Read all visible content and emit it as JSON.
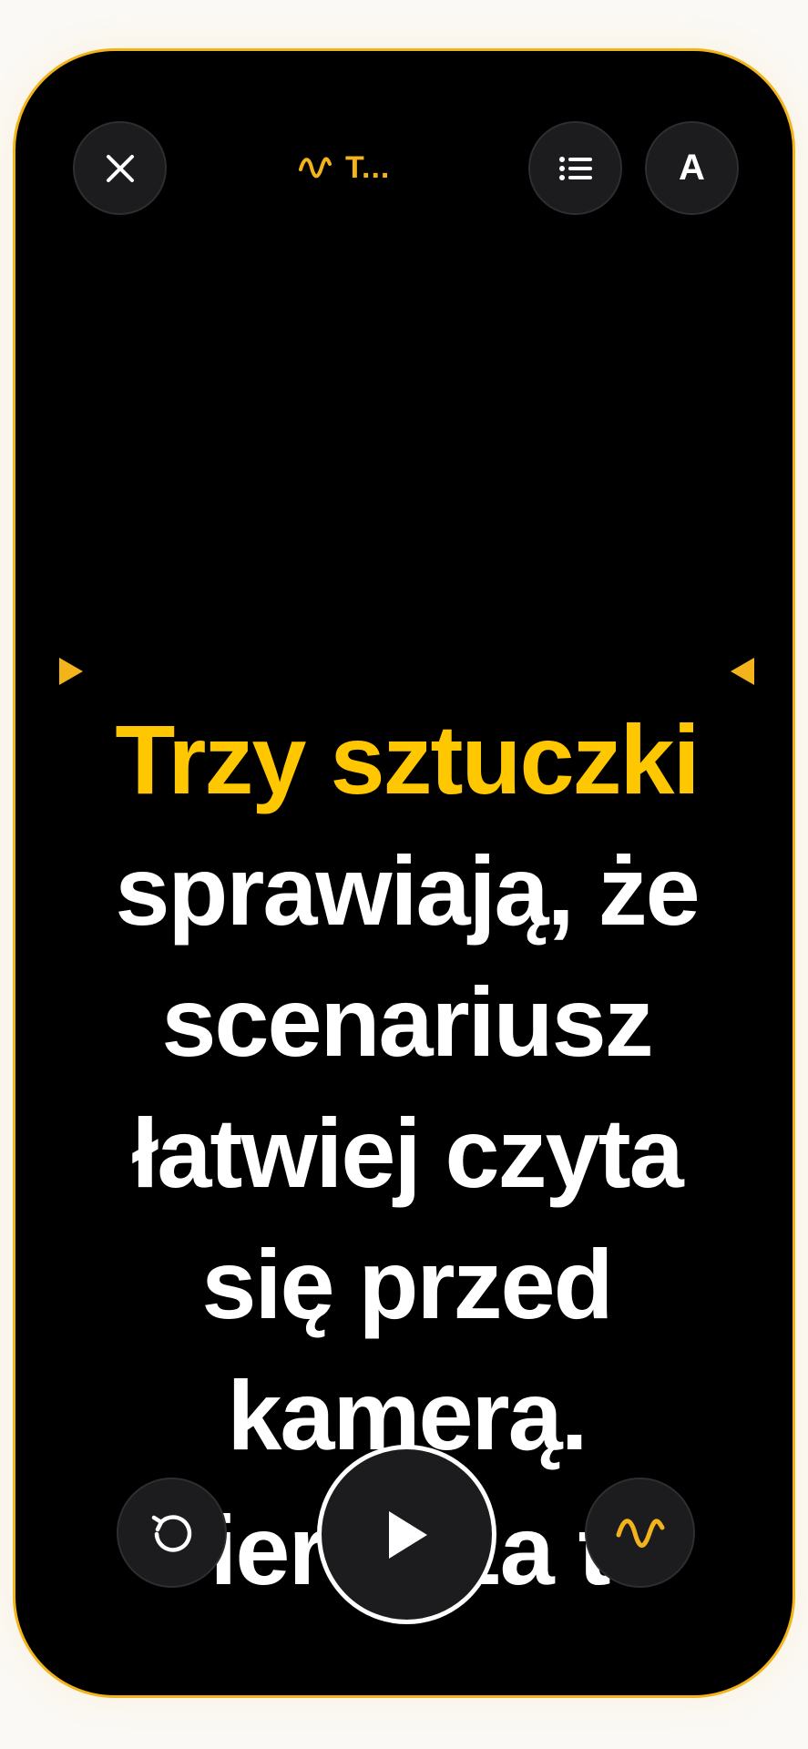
{
  "header": {
    "title": "T...",
    "close_icon": "close-icon",
    "mode_icon": "waveform-icon",
    "list_icon": "list-icon",
    "font_button_label": "A"
  },
  "script": {
    "highlighted": "Trzy sztuczki",
    "lines": [
      "sprawiają, że",
      "scenariusz",
      "łatwiej czyta",
      "się przed",
      "kamerą."
    ],
    "next_line": "Pierwsza to"
  },
  "controls": {
    "reset_icon": "rewind-icon",
    "play_icon": "play-icon",
    "voice_icon": "waveform-icon"
  },
  "colors": {
    "accent": "#f2b41a",
    "highlight": "#ffc700",
    "background": "#000000",
    "button": "#1c1c1e"
  }
}
